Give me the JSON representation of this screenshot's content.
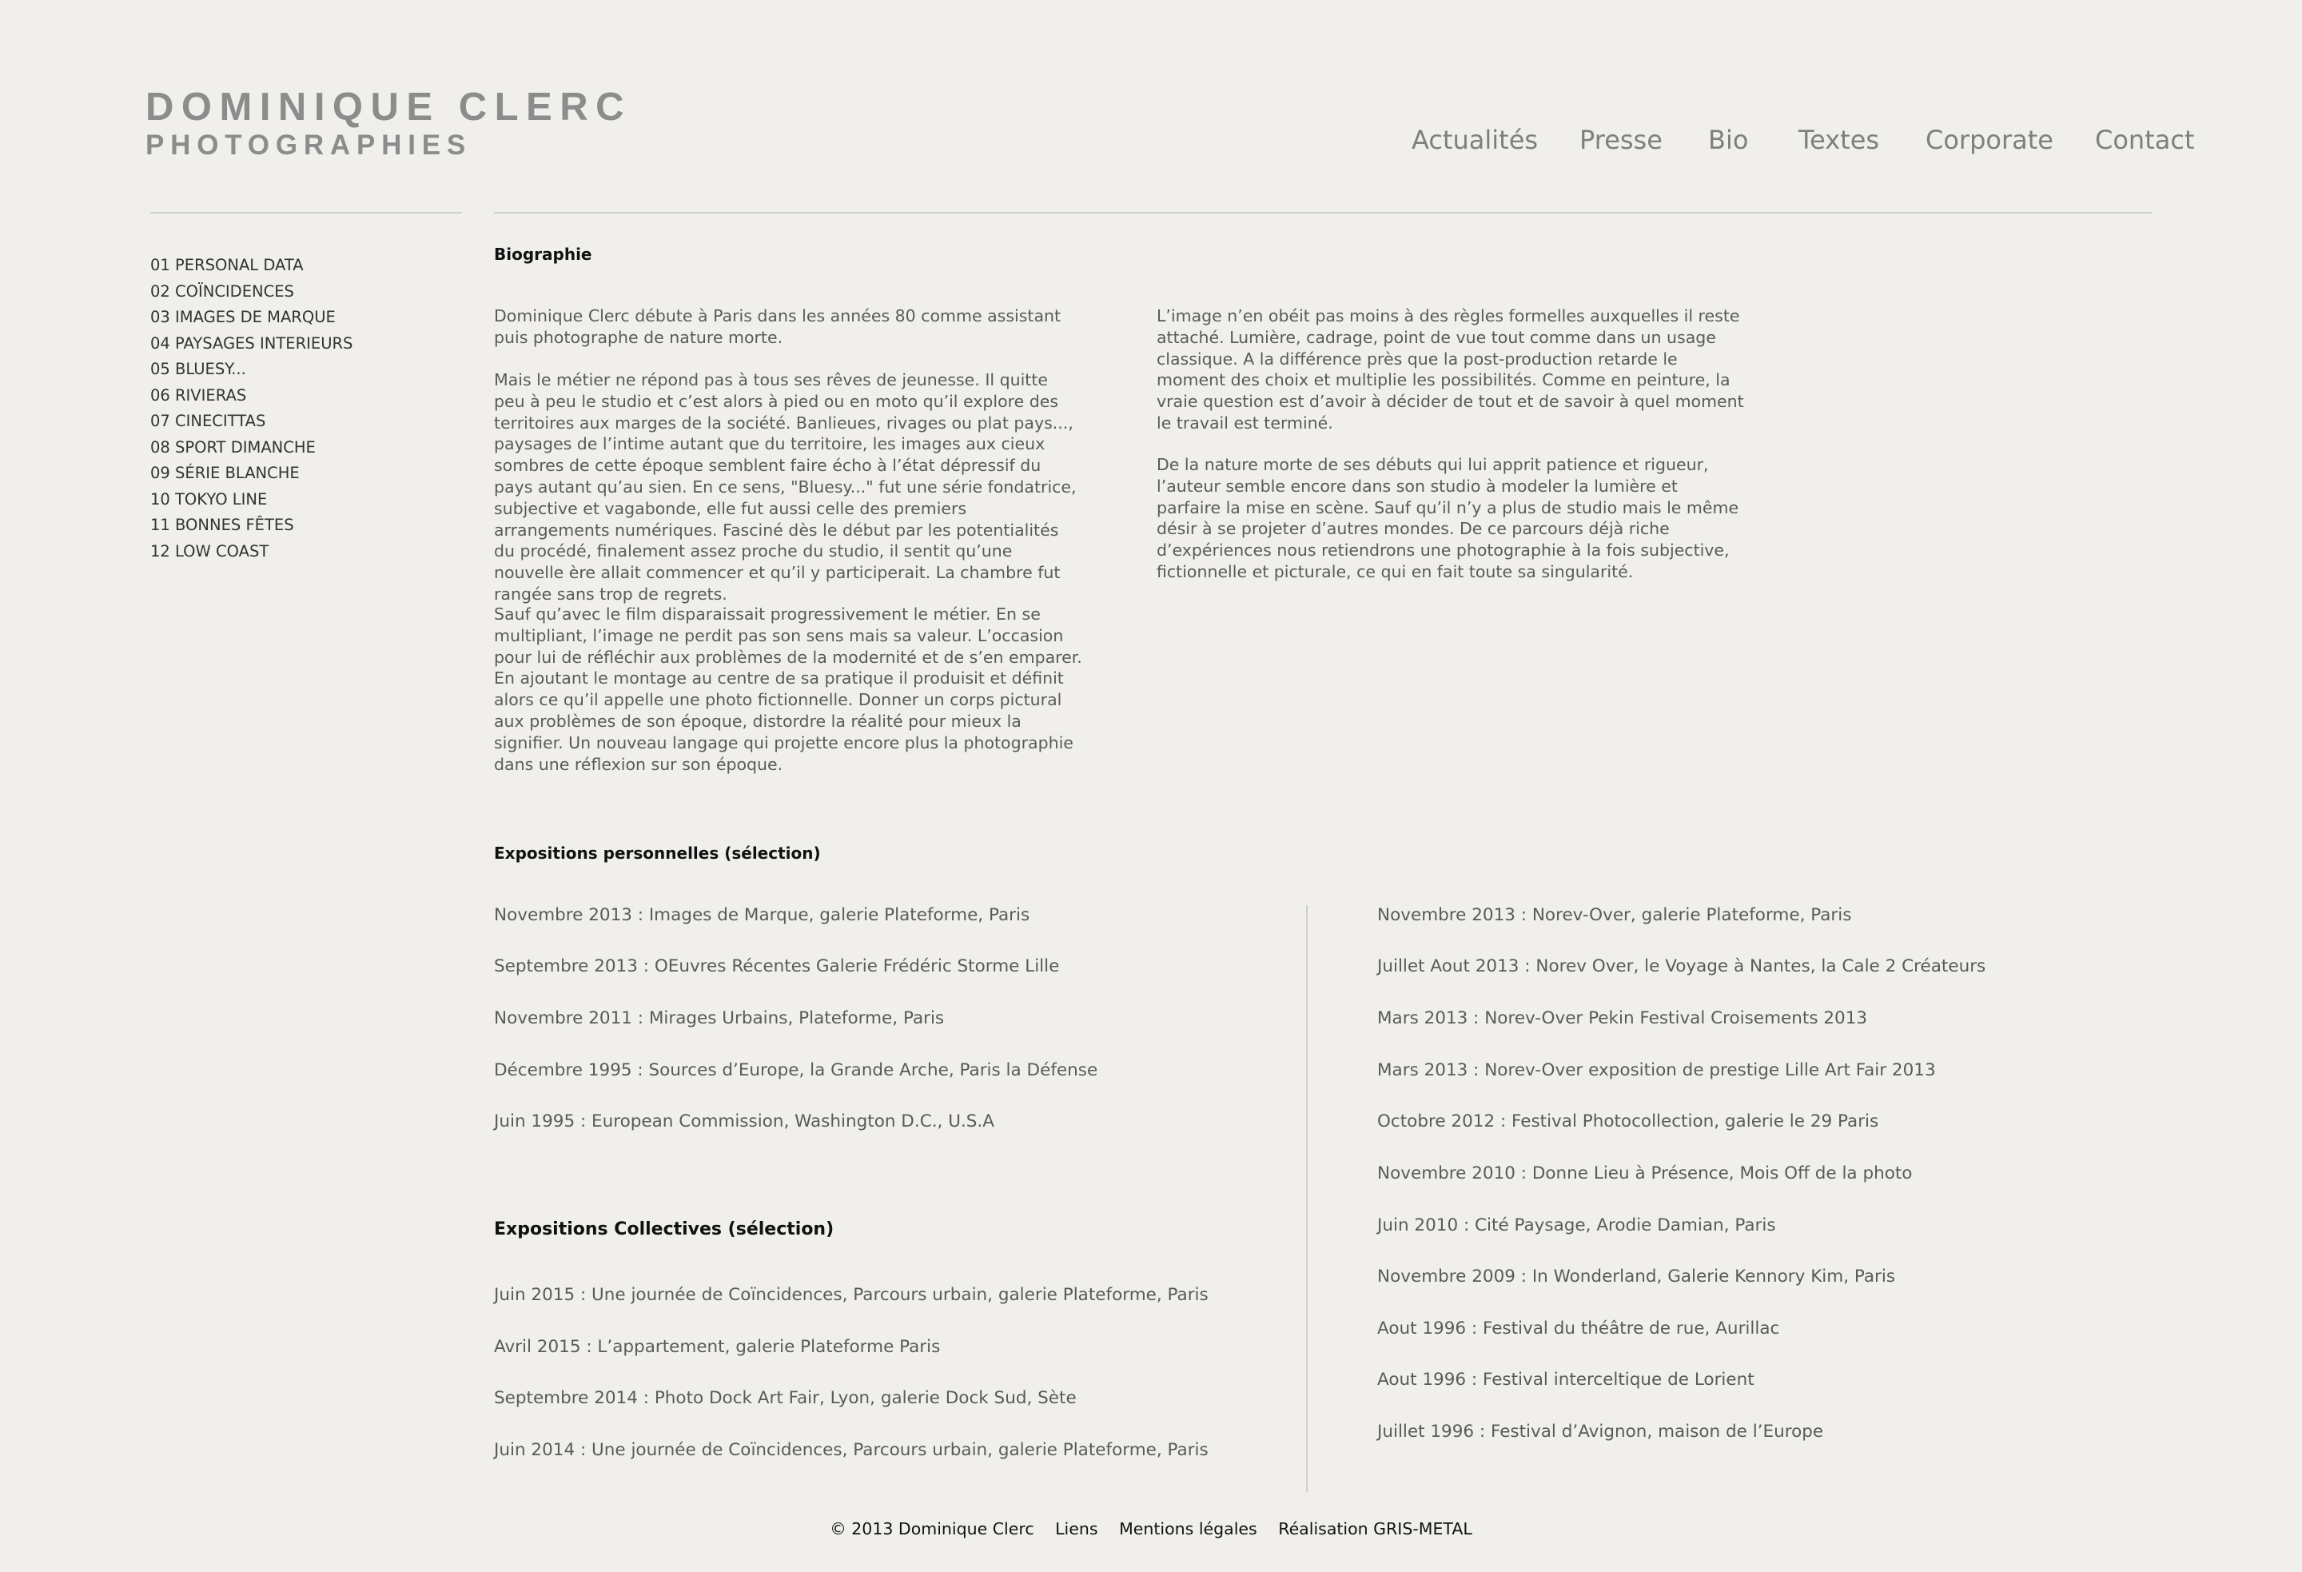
{
  "logo": {
    "name": "DOMINIQUE CLERC",
    "subtitle": "PHOTOGRAPHIES"
  },
  "nav": [
    "Actualités",
    "Presse",
    "Bio",
    "Textes",
    "Corporate",
    "Contact"
  ],
  "sidebar": [
    "01 PERSONAL DATA",
    "02 COÏNCIDENCES",
    "03 IMAGES DE MARQUE",
    "04 PAYSAGES INTERIEURS",
    "05 BLUESY...",
    "06 RIVIERAS",
    "07 CINECITTAS",
    "08 SPORT DIMANCHE",
    "09 SÉRIE BLANCHE",
    "10 TOKYO LINE",
    "11 BONNES FÊTES",
    "12 LOW COAST"
  ],
  "bio": {
    "heading": "Biographie",
    "left": [
      "Dominique Clerc débute à Paris dans les années 80 comme assistant puis photographe de nature morte.",
      "Mais le métier ne répond pas à tous ses rêves de jeunesse. Il quitte peu à peu le studio et c’est alors à pied ou en moto qu’il explore des territoires aux marges de la société. Banlieues, rivages ou plat pays..., paysages de l’intime autant que du territoire, les images aux cieux sombres de cette époque semblent faire écho à l’état dépressif du pays autant qu’au sien. En ce sens, \"Bluesy...\" fut une série fondatrice, subjective et vagabonde, elle fut aussi celle des premiers arrangements numériques. Fasciné dès le début par les potentialités du procédé, finalement assez proche du studio, il sentit qu’une nouvelle ère allait commencer et qu’il y participerait. La chambre fut rangée sans trop de regrets.",
      "Sauf qu’avec le film disparaissait progressivement le métier. En se multipliant, l’image ne perdit pas son sens mais sa valeur. L’occasion pour lui de réfléchir aux problèmes de la modernité et de s’en emparer. En ajoutant le montage au centre de sa pratique il produisit et définit alors ce qu’il appelle une photo fictionnelle. Donner un corps pictural aux problèmes de son époque, distordre la réalité pour mieux la signifier. Un nouveau langage qui projette encore plus la photographie dans une réflexion sur son époque."
    ],
    "right": [
      "L’image n’en obéit pas moins à des règles formelles auxquelles il reste attaché. Lumière, cadrage, point de vue tout comme dans un usage classique. A la différence près que la post-production retarde le moment des choix et multiplie les possibilités. Comme en peinture, la vraie question est d’avoir à décider de tout et de savoir à quel moment le travail est terminé.",
      "De la nature morte de ses débuts qui lui apprit patience et rigueur, l’auteur semble encore dans son studio à modeler la lumière et parfaire la mise en scène. Sauf qu’il n’y a plus de studio mais le même désir à se projeter d’autres mondes. De ce parcours déjà riche d’expériences nous retiendrons une photographie à la fois subjective, fictionnelle et picturale, ce qui en fait toute sa singularité."
    ]
  },
  "expos_personal": {
    "heading": "Expositions personnelles (sélection)",
    "items": [
      "Novembre 2013 : Images de Marque, galerie Plateforme, Paris",
      "Septembre 2013 : OEuvres Récentes Galerie Frédéric Storme Lille",
      "Novembre 2011 : Mirages Urbains, Plateforme, Paris",
      "Décembre 1995 : Sources d’Europe, la Grande Arche, Paris la Défense",
      "Juin 1995 : European Commission, Washington D.C., U.S.A"
    ]
  },
  "expos_collective": {
    "heading": "Expositions Collectives (sélection)",
    "items": [
      "Juin 2015 : Une journée de Coïncidences, Parcours urbain, galerie Plateforme, Paris",
      "Avril 2015 : L’appartement, galerie Plateforme Paris",
      "Septembre 2014 : Photo Dock Art Fair, Lyon, galerie Dock Sud, Sète",
      "Juin 2014 : Une journée de Coïncidences, Parcours urbain, galerie Plateforme, Paris"
    ]
  },
  "expos_right": [
    "Novembre 2013 : Norev-Over, galerie Plateforme, Paris",
    "Juillet Aout 2013 : Norev Over, le Voyage à Nantes, la Cale 2 Créateurs",
    "Mars 2013 : Norev-Over Pekin Festival Croisements 2013",
    "Mars 2013 : Norev-Over exposition de prestige Lille Art Fair 2013",
    "Octobre 2012 : Festival Photocollection, galerie le 29 Paris",
    "Novembre 2010 : Donne Lieu à Présence, Mois Off de la photo",
    "Juin 2010 : Cité Paysage, Arodie Damian, Paris",
    "Novembre 2009 : In Wonderland, Galerie Kennory Kim, Paris",
    "Aout 1996 : Festival du théâtre de rue, Aurillac",
    "Aout 1996 : Festival interceltique de Lorient",
    "Juillet 1996 : Festival d’Avignon, maison de l’Europe"
  ],
  "footer": {
    "copyright": "© 2013 Dominique Clerc",
    "links": "Liens",
    "legal": "Mentions légales",
    "credit": "Réalisation GRIS-METAL"
  }
}
